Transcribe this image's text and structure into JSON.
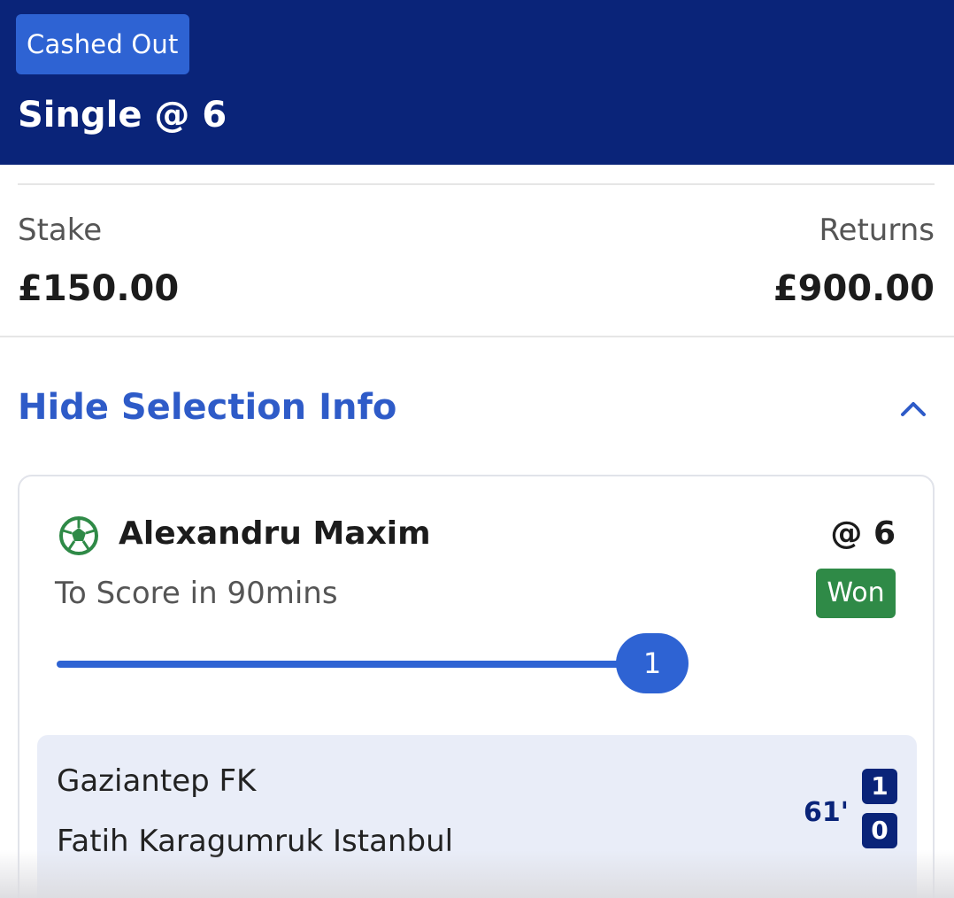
{
  "header": {
    "status": "Cashed Out",
    "title": "Single @ 6"
  },
  "summary": {
    "stake_label": "Stake",
    "stake_value": "£150.00",
    "returns_label": "Returns",
    "returns_value": "£900.00"
  },
  "selection_toggle": {
    "label": "Hide Selection Info",
    "icon": "chevron-up-icon"
  },
  "selection": {
    "sport_icon": "football-icon",
    "name": "Alexandru Maxim",
    "odds": "@ 6",
    "market": "To Score in 90mins",
    "result": "Won",
    "progress_value": "1",
    "progress_fraction": 1.0
  },
  "match": {
    "home_team": "Gaziantep FK",
    "away_team": "Fatih Karagumruk Istanbul",
    "time": "61'",
    "home_score": "1",
    "away_score": "0"
  },
  "colors": {
    "header_bg": "#0a2479",
    "accent": "#2e63d3",
    "won": "#2f8a47",
    "link": "#2e5bc8"
  }
}
